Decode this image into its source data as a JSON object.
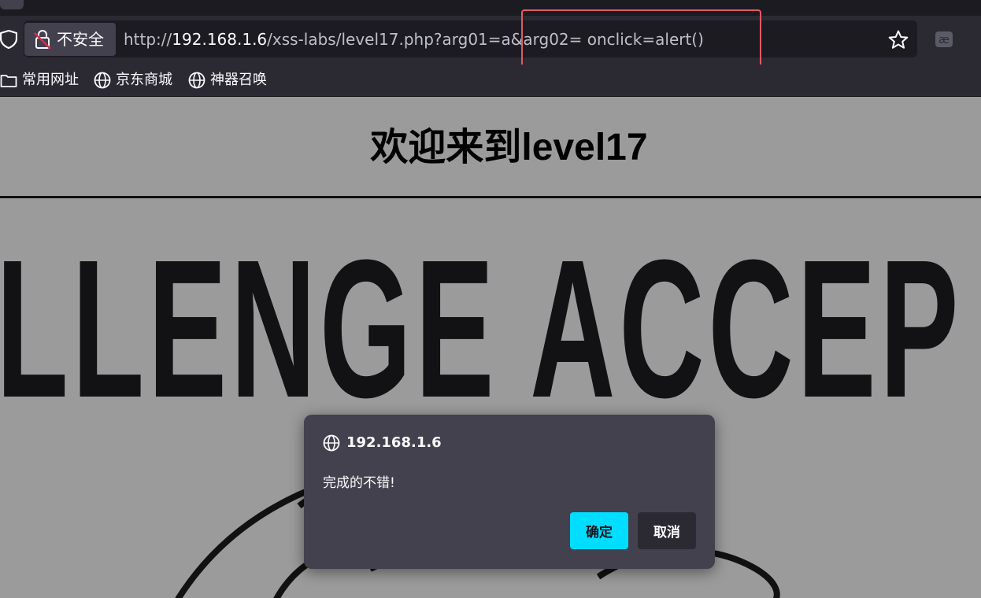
{
  "browser": {
    "security_label": "不安全",
    "url": {
      "scheme": "http://",
      "host": "192.168.1.6",
      "path": "/xss-labs/level17.php?arg01=a&arg02= onclick=alert()"
    }
  },
  "bookmarks": [
    {
      "label": "常用网址",
      "icon": "folder-icon"
    },
    {
      "label": "京东商城",
      "icon": "globe-icon"
    },
    {
      "label": "神器召唤",
      "icon": "globe-icon"
    }
  ],
  "page": {
    "title": "欢迎来到level17",
    "banner_text": "ALLENGE ACCEP"
  },
  "dialog": {
    "host": "192.168.1.6",
    "message": "完成的不错!",
    "ok_label": "确定",
    "cancel_label": "取消"
  },
  "colors": {
    "accent": "#00ddff",
    "annotation": "#e05b66",
    "page_background": "#9b9b9b"
  }
}
